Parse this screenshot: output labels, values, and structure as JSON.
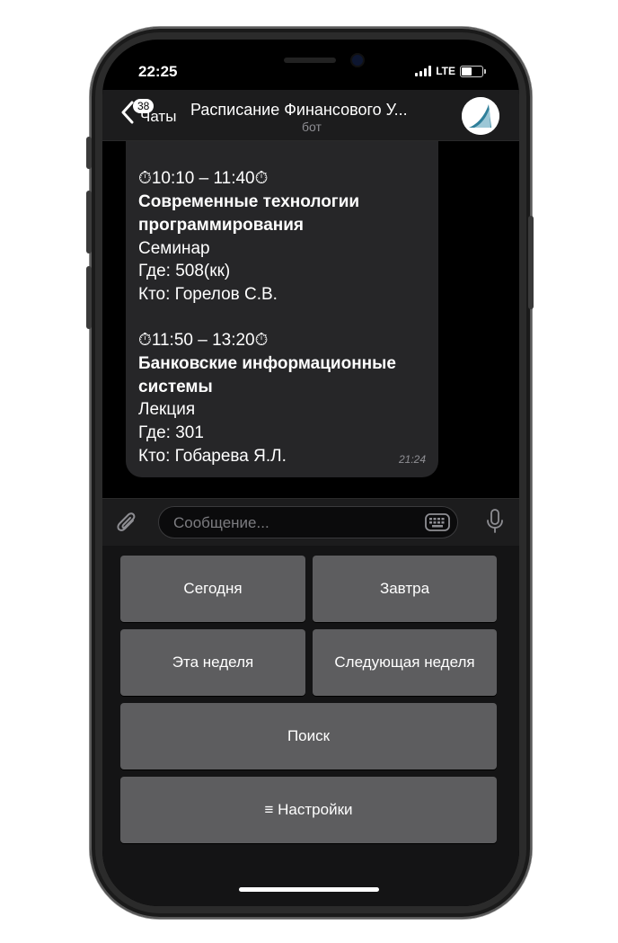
{
  "status": {
    "time": "22:25",
    "network": "LTE",
    "battery_level": 0.55
  },
  "header": {
    "back_label": "Чаты",
    "unread_count": "38",
    "title": "Расписание Финансового У...",
    "subtitle": "бот"
  },
  "message": {
    "lines": [
      {
        "text": "Кто: Гобарева Я.Л.",
        "bold": false
      },
      {
        "text": "",
        "bold": false
      },
      {
        "text": "⏱10:10 – 11:40⏱",
        "bold": false
      },
      {
        "text": "Современные технологии",
        "bold": true
      },
      {
        "text": "программирования",
        "bold": true
      },
      {
        "text": "Семинар",
        "bold": false
      },
      {
        "text": "Где: 508(кк)",
        "bold": false
      },
      {
        "text": "Кто: Горелов С.В.",
        "bold": false
      },
      {
        "text": "",
        "bold": false
      },
      {
        "text": "⏱11:50 – 13:20⏱",
        "bold": false
      },
      {
        "text": "Банковские информационные",
        "bold": true
      },
      {
        "text": "системы",
        "bold": true
      },
      {
        "text": "Лекция",
        "bold": false
      },
      {
        "text": "Где: 301",
        "bold": false
      },
      {
        "text": "Кто: Гобарева Я.Л.",
        "bold": false
      }
    ],
    "time": "21:24"
  },
  "input": {
    "placeholder": "Сообщение..."
  },
  "keyboard": {
    "today": "Сегодня",
    "tomorrow": "Завтра",
    "this_week": "Эта неделя",
    "next_week": "Следующая неделя",
    "search": "Поиск",
    "settings": "≡ Настройки"
  },
  "icons": {
    "back": "chevron-left-icon",
    "attach": "paperclip-icon",
    "keyboard": "keyboard-icon",
    "mic": "microphone-icon"
  }
}
